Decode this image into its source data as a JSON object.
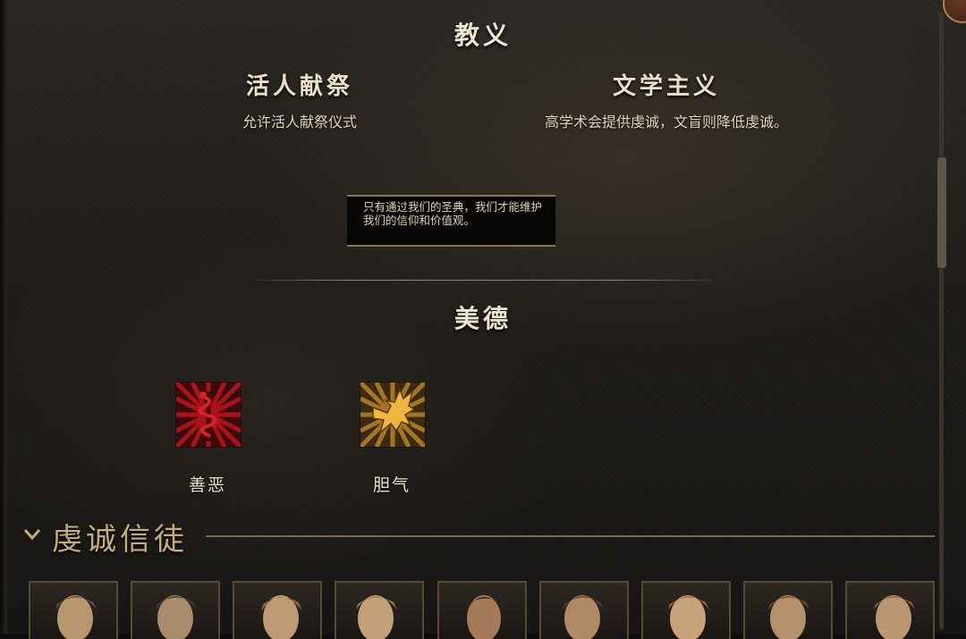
{
  "doctrine": {
    "title": "教义",
    "tenets": [
      {
        "name": "活人献祭",
        "description": "允许活人献祭仪式"
      },
      {
        "name": "文学主义",
        "description": "高学术会提供虔诚，文盲则降低虔诚。"
      }
    ],
    "quote": "只有通过我们的圣典，我们才能维护我们的信仰和价值观。"
  },
  "virtues": {
    "title": "美德",
    "items": [
      {
        "label": "善恶",
        "icon": "caduceus-icon",
        "color": "#b8141c"
      },
      {
        "label": "胆气",
        "icon": "eagle-icon",
        "color": "#e0a63a"
      }
    ]
  },
  "followers": {
    "title": "虔诚信徒",
    "portraits": [
      {
        "icon": "follower-portrait"
      },
      {
        "icon": "follower-portrait"
      },
      {
        "icon": "follower-portrait"
      },
      {
        "icon": "follower-portrait"
      },
      {
        "icon": "follower-portrait"
      },
      {
        "icon": "follower-portrait"
      },
      {
        "icon": "follower-portrait"
      },
      {
        "icon": "follower-portrait"
      },
      {
        "icon": "follower-portrait"
      }
    ]
  },
  "colors": {
    "accent": "#9a8458",
    "text": "#e9ddc4",
    "heading_gold": "#c6ad7d"
  }
}
